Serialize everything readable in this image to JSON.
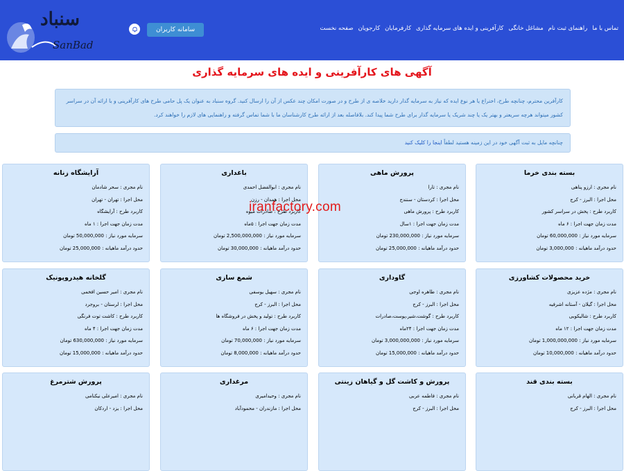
{
  "header": {
    "logo_text_fa": "سنباد",
    "logo_text_en": "SanBad",
    "login_button": "سامانه کاربران",
    "nav": [
      "صفحه نخست",
      "کارجویان",
      "کارفرمایان",
      "کارآفرینی و ایده های سرمایه گذاری",
      "مشاغل خانگی",
      "راهنمای ثبت نام",
      "تماس با ما"
    ]
  },
  "page_title": "آگهی های کارآفرینی و ایده های سرمایه گذاری",
  "info_text": "کارآفرین محترم، چنانچه طرح، اختراع یا هر نوع ایده که نیاز به سرمایه گذار دارید خلاصه ی از طرح و در صورت امکان چند عکس از آن را ارسال کنید. گروه سنباد به عنوان یک پل حامی طرح های کارآفرینی و با ارائه آن در سراسر کشور میتواند هرچه سریعتر و بهتر یک یا چند شریک یا سرمایه گذار برای طرح شما پیدا کند. بلافاصله بعد از ارائه طرح کارشناسان ما با شما تماس گرفته و راهنمایی های لازم را خواهند کرد.",
  "cta": {
    "text": "چنانچه مایل به ثبت آگهی خود در این زمینه هستید لطفاً",
    "link": "اینجا را کلیک کنید"
  },
  "watermark": "iranfactory.com",
  "cards": [
    {
      "title": "بسته بندی خرما",
      "rows": [
        "نام مجری : ارزو پناهی",
        "محل اجرا : البرز - کرج",
        "کاربرد طرح : پخش در سراسر کشور",
        "مدت زمان جهت اجرا : ۶ ماه",
        "سرمایه مورد نیاز : 60,000,000 تومان",
        "حدود درآمد ماهیانه : 3,000,000 تومان"
      ]
    },
    {
      "title": "پرورش ماهی",
      "rows": [
        "نام مجری : تارا",
        "محل اجرا : کردستان - سنندج",
        "کاربرد طرح : پرورش ماهی",
        "مدت زمان جهت اجرا : ۱سال",
        "سرمایه مورد نیاز : 230,000,000 تومان",
        "حدود درآمد ماهیانه : 25,000,000 تومان"
      ]
    },
    {
      "title": "باغداری",
      "rows": [
        "نام مجری : ابوالفضل احمدی",
        "محل اجرا : همدان - رزن",
        "کاربرد طرح : صادرات میوه",
        "مدت زمان جهت اجرا : ۵ماه",
        "سرمایه مورد نیاز : 2,500,000,000 تومان",
        "حدود درآمد ماهیانه : 30,000,000 تومان"
      ]
    },
    {
      "title": "آرایشگاه زنانه",
      "rows": [
        "نام مجری : سحر شادمان",
        "محل اجرا : تهران - تهران",
        "کاربرد طرح : آرایشگاه",
        "مدت زمان جهت اجرا : ۱ ماه",
        "سرمایه مورد نیاز : 50,000,000 تومان",
        "حدود درآمد ماهیانه : 25,000,000 تومان"
      ]
    },
    {
      "title": "خرید محصولات کشاورزی",
      "rows": [
        "نام مجری : مژده عزیزی",
        "محل اجرا : گیلان - آستانه اشرفیه",
        "کاربرد طرح : شالیکوبی",
        "مدت زمان جهت اجرا : ۱۲ ماه",
        "سرمایه مورد نیاز : 1,000,000,000 تومان",
        "حدود درآمد ماهیانه : 10,000,000 تومان"
      ]
    },
    {
      "title": "گاوداری",
      "rows": [
        "نام مجری : طاهره اوجی",
        "محل اجرا : البرز - کرج",
        "کاربرد طرح : گوشت،شیر،پوست،صادرات",
        "مدت زمان جهت اجرا : ۲۴ماه",
        "سرمایه مورد نیاز : 3,000,000,000 تومان",
        "حدود درآمد ماهیانه : 15,000,000 تومان"
      ]
    },
    {
      "title": "شمع سازی",
      "rows": [
        "نام مجری : سهیل یوسفی",
        "محل اجرا : البرز - کرج",
        "کاربرد طرح : تولید و پخش در فروشگاه ها",
        "مدت زمان جهت اجرا : ۶ ماه",
        "سرمایه مورد نیاز : 70,000,000 تومان",
        "حدود درآمد ماهیانه : 8,000,000 تومان"
      ]
    },
    {
      "title": "گلخانه هیدروپونیک",
      "rows": [
        "نام مجری : امیر حسین افخمی",
        "محل اجرا : لرستان - بروجرد",
        "کاربرد طرح : کاشت توت فرنگی",
        "مدت زمان جهت اجرا : ۴ ماه",
        "سرمایه مورد نیاز : 630,000,000 تومان",
        "حدود درآمد ماهیانه : 15,000,000 تومان"
      ]
    },
    {
      "title": "بسته بندی قند",
      "rows": [
        "نام مجری : الهام قربانی",
        "محل اجرا : البرز - کرج"
      ]
    },
    {
      "title": "پرورش و کاشت گل و گیاهان زینتی",
      "rows": [
        "نام مجری : فاطمه عربی",
        "محل اجرا : البرز - کرج"
      ]
    },
    {
      "title": "مرغداری",
      "rows": [
        "نام مجری : وحیدامیری",
        "محل اجرا : مازندران - محمودآباد"
      ]
    },
    {
      "title": "پرورش شترمرغ",
      "rows": [
        "نام مجری : امیرعلی نیکنامی",
        "محل اجرا : یزد - اردکان"
      ]
    }
  ]
}
